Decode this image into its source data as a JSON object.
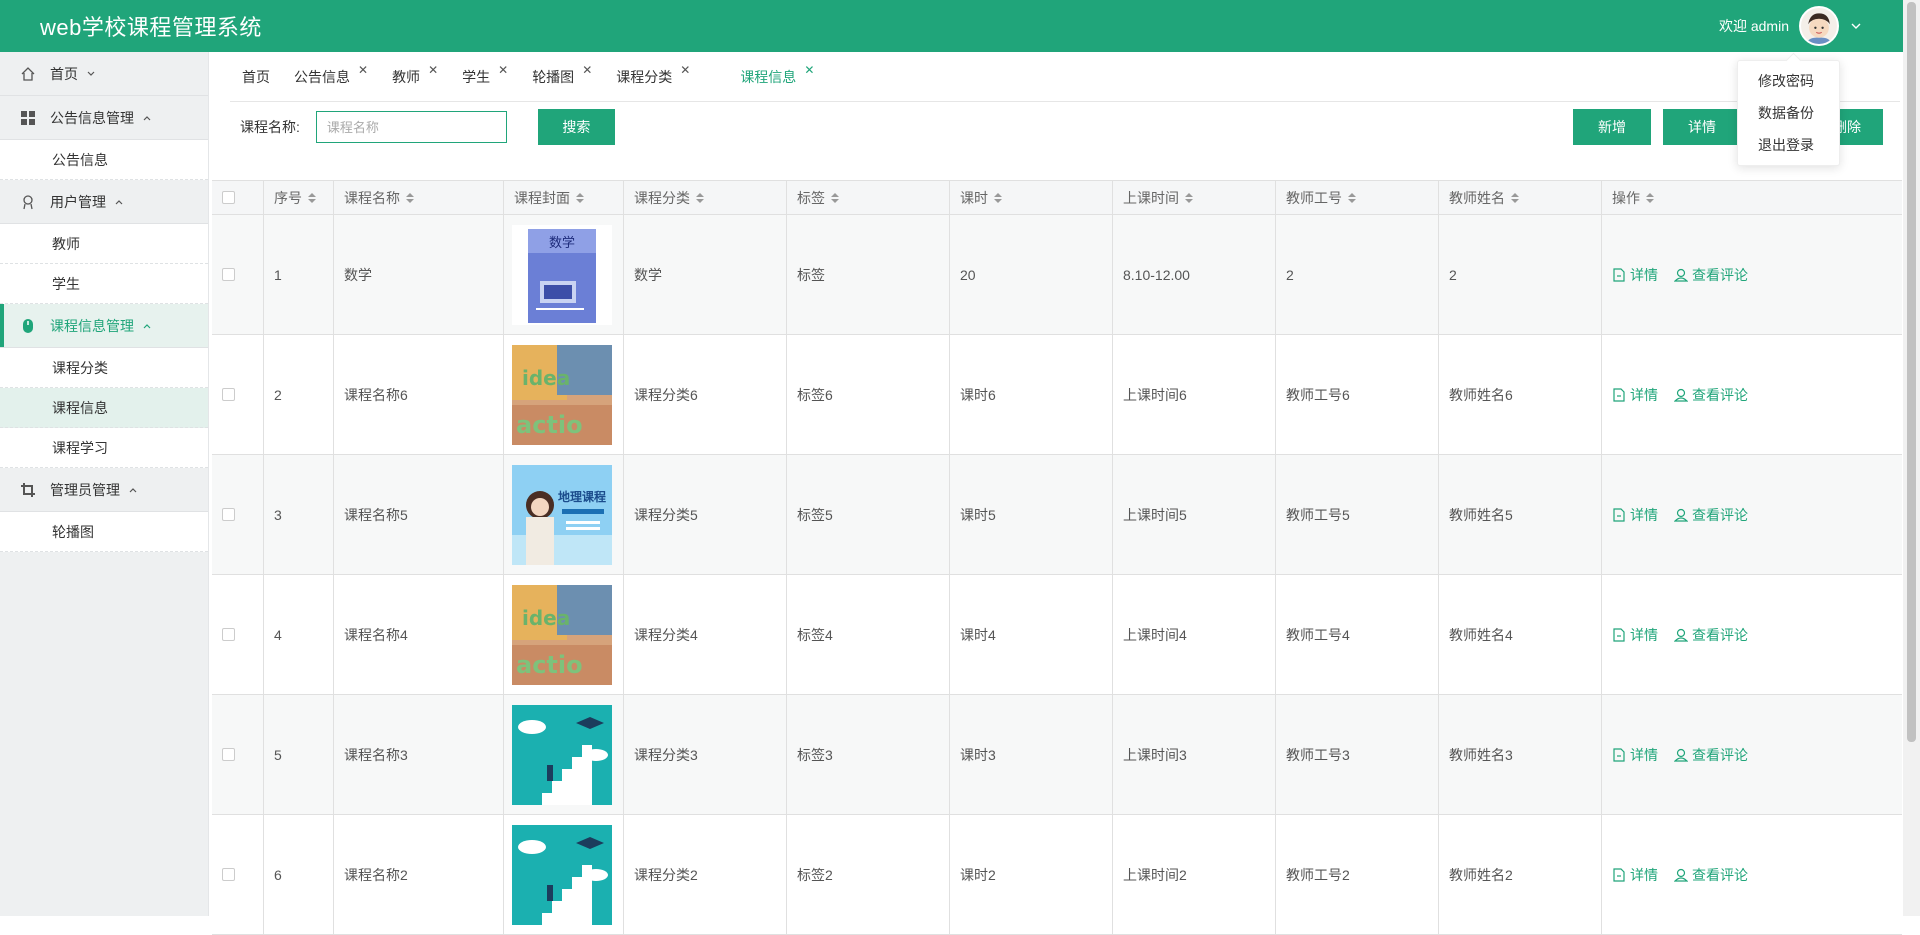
{
  "app": {
    "title": "web学校课程管理系统"
  },
  "header": {
    "welcome": "欢迎 admin"
  },
  "user_menu": [
    "修改密码",
    "数据备份",
    "退出登录"
  ],
  "sidebar": {
    "home": "首页",
    "groups": [
      {
        "label": "公告信息管理",
        "items": [
          "公告信息"
        ]
      },
      {
        "label": "用户管理",
        "items": [
          "教师",
          "学生"
        ]
      },
      {
        "label": "课程信息管理",
        "items": [
          "课程分类",
          "课程信息",
          "课程学习"
        ]
      },
      {
        "label": "管理员管理",
        "items": [
          "轮播图"
        ]
      }
    ]
  },
  "tabs": [
    "首页",
    "公告信息",
    "教师",
    "学生",
    "轮播图",
    "课程分类",
    "课程信息"
  ],
  "search": {
    "label": "课程名称:",
    "placeholder": "课程名称",
    "button": "搜索"
  },
  "toolbar": {
    "add": "新增",
    "detail": "详情",
    "delete": "删除"
  },
  "table": {
    "columns": [
      "序号",
      "课程名称",
      "课程封面",
      "课程分类",
      "标签",
      "课时",
      "上课时间",
      "教师工号",
      "教师姓名",
      "操作"
    ],
    "actions": [
      "详情",
      "查看评论"
    ],
    "rows": [
      {
        "no": "1",
        "name": "数学",
        "cover": "math-book",
        "category": "数学",
        "tag": "标签",
        "hours": "20",
        "time": "8.10-12.00",
        "teacher_id": "2",
        "teacher_name": "2"
      },
      {
        "no": "2",
        "name": "课程名称6",
        "cover": "action",
        "category": "课程分类6",
        "tag": "标签6",
        "hours": "课时6",
        "time": "上课时间6",
        "teacher_id": "教师工号6",
        "teacher_name": "教师姓名6"
      },
      {
        "no": "3",
        "name": "课程名称5",
        "cover": "geography",
        "category": "课程分类5",
        "tag": "标签5",
        "hours": "课时5",
        "time": "上课时间5",
        "teacher_id": "教师工号5",
        "teacher_name": "教师姓名5"
      },
      {
        "no": "4",
        "name": "课程名称4",
        "cover": "action",
        "category": "课程分类4",
        "tag": "标签4",
        "hours": "课时4",
        "time": "上课时间4",
        "teacher_id": "教师工号4",
        "teacher_name": "教师姓名4"
      },
      {
        "no": "5",
        "name": "课程名称3",
        "cover": "stairs",
        "category": "课程分类3",
        "tag": "标签3",
        "hours": "课时3",
        "time": "上课时间3",
        "teacher_id": "教师工号3",
        "teacher_name": "教师姓名3"
      },
      {
        "no": "6",
        "name": "课程名称2",
        "cover": "stairs",
        "category": "课程分类2",
        "tag": "标签2",
        "hours": "课时2",
        "time": "上课时间2",
        "teacher_id": "教师工号2",
        "teacher_name": "教师姓名2"
      }
    ]
  },
  "colors": {
    "primary": "#20a57a"
  }
}
